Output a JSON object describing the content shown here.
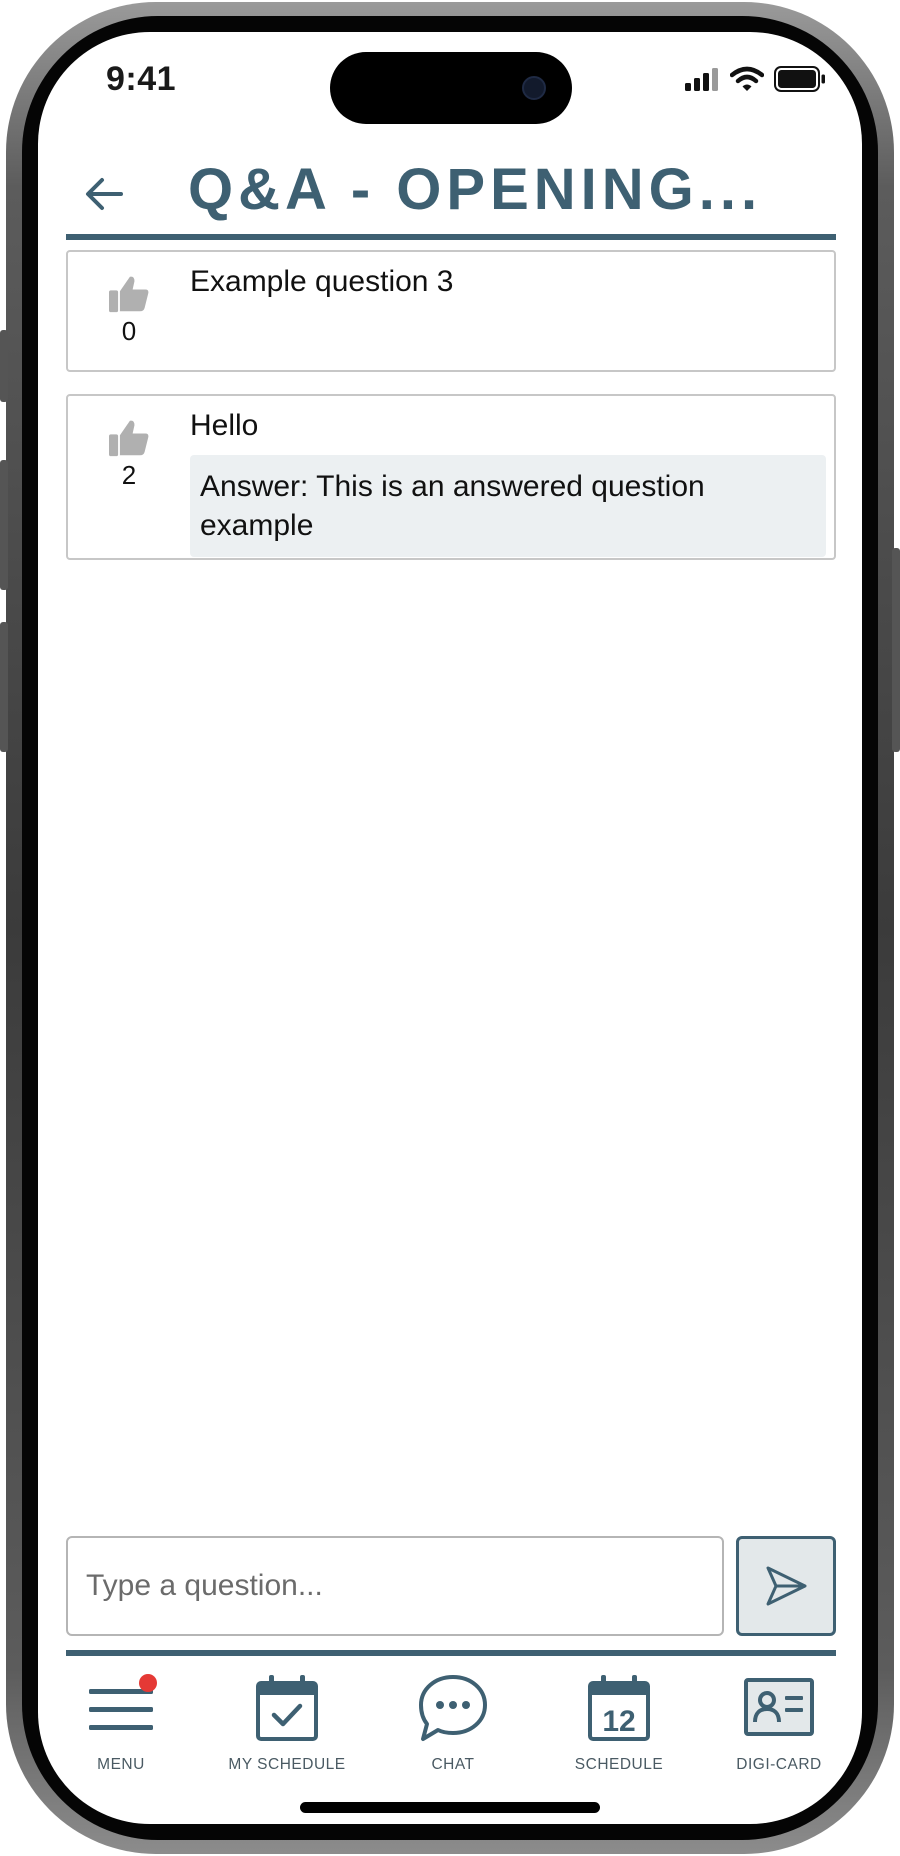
{
  "status_bar": {
    "time": "9:41",
    "icons": [
      "cellular-signal-icon",
      "wifi-icon",
      "battery-icon"
    ]
  },
  "header": {
    "back_icon": "back-arrow-icon",
    "title": "Q&A - OPENING..."
  },
  "questions": [
    {
      "text": "Example question 3",
      "votes": "0",
      "answer": null
    },
    {
      "text": "Hello",
      "votes": "2",
      "answer": "Answer: This is an answered question example"
    }
  ],
  "compose": {
    "placeholder": "Type a question...",
    "send_icon": "send-icon"
  },
  "bottom_nav": {
    "items": [
      {
        "label": "MENU",
        "icon": "hamburger-menu-icon",
        "has_badge": true
      },
      {
        "label": "MY SCHEDULE",
        "icon": "calendar-check-icon"
      },
      {
        "label": "CHAT",
        "icon": "chat-bubble-icon"
      },
      {
        "label": "SCHEDULE",
        "icon": "calendar-12-icon",
        "icon_text": "12"
      },
      {
        "label": "DIGI-CARD",
        "icon": "contact-card-icon"
      }
    ]
  },
  "colors": {
    "accent": "#3e6072",
    "answer_background": "#ecf0f2",
    "thumb_icon": "#b0b0b0",
    "notification_badge": "#e53935"
  }
}
